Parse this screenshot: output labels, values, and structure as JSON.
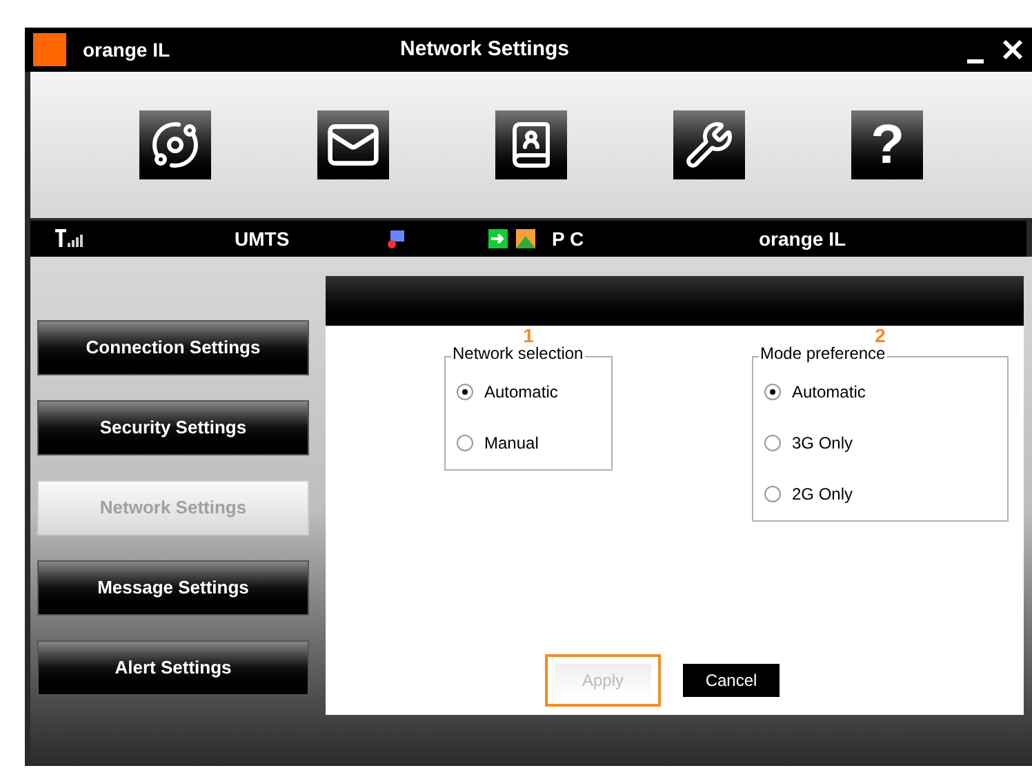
{
  "window": {
    "brand": "orange IL",
    "title": "Network Settings"
  },
  "toolbar": [
    {
      "kind": "globe"
    },
    {
      "kind": "mail"
    },
    {
      "kind": "contacts"
    },
    {
      "kind": "tools"
    },
    {
      "kind": "help",
      "label": "?"
    }
  ],
  "status_bar": {
    "network_type": "UMTS",
    "connection": "P C",
    "operator": "orange IL"
  },
  "sidebar": [
    {
      "label": "Connection Settings",
      "selected": false
    },
    {
      "label": "Security Settings",
      "selected": false
    },
    {
      "label": "Network Settings",
      "selected": true
    },
    {
      "label": "Message Settings",
      "selected": false
    },
    {
      "label": "Alert Settings",
      "selected": false
    }
  ],
  "groups": [
    {
      "marker": "1",
      "title": "Network selection",
      "options": [
        {
          "label": "Automatic",
          "selected": true
        },
        {
          "label": "Manual",
          "selected": false
        }
      ]
    },
    {
      "marker": "2",
      "title": "Mode preference",
      "options": [
        {
          "label": "Automatic",
          "selected": true
        },
        {
          "label": "3G Only",
          "selected": false
        },
        {
          "label": "2G Only",
          "selected": false
        }
      ]
    }
  ],
  "buttons": [
    {
      "label": "Apply",
      "disabled": true,
      "highlighted": true
    },
    {
      "label": "Cancel",
      "disabled": false,
      "highlighted": false
    }
  ]
}
